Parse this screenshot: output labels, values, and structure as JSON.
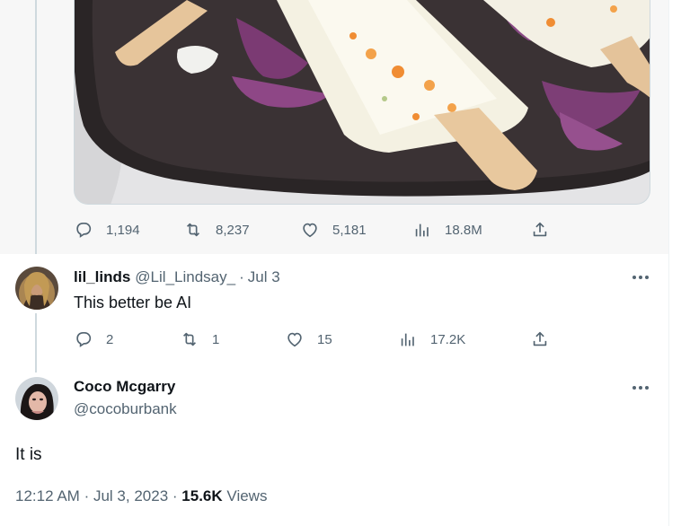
{
  "top_tweet": {
    "media_description": "popsicle-image",
    "actions": {
      "replies": "1,194",
      "retweets": "8,237",
      "likes": "5,181",
      "views": "18.8M"
    }
  },
  "reply": {
    "display_name": "lil_linds",
    "handle": "@Lil_Lindsay_",
    "separator": "·",
    "date": "Jul 3",
    "text": "This better be AI",
    "actions": {
      "replies": "2",
      "retweets": "1",
      "likes": "15",
      "views": "17.2K"
    }
  },
  "main_tweet": {
    "display_name": "Coco Mcgarry",
    "handle": "@cocoburbank",
    "text": "It is",
    "time": "12:12 AM",
    "separator": "·",
    "date": "Jul 3, 2023",
    "views_count": "15.6K",
    "views_label": "Views"
  },
  "colors": {
    "muted": "#536471",
    "text": "#0f1419",
    "thread_line": "#cfd9de",
    "hover_bg": "#f7f7f7"
  },
  "icons": [
    "reply-icon",
    "retweet-icon",
    "like-icon",
    "views-icon",
    "share-icon",
    "more-icon"
  ]
}
